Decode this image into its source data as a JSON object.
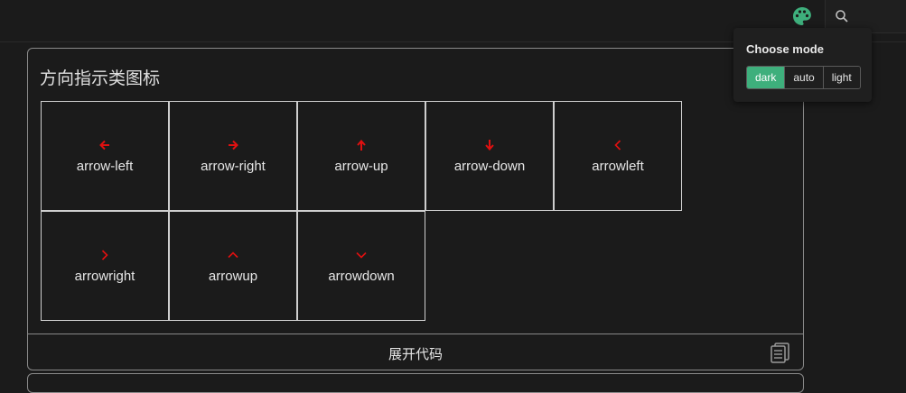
{
  "colors": {
    "accent": "#3eaf7c",
    "icon_red": "#e01010",
    "background": "#1b1b1b",
    "border": "#cfcfcf"
  },
  "topbar": {
    "palette_icon": "palette-icon",
    "search_icon": "search-icon"
  },
  "card": {
    "title": "方向指示类图标",
    "icons": [
      {
        "label": "arrow-left",
        "icon": "arrow-left-icon"
      },
      {
        "label": "arrow-right",
        "icon": "arrow-right-icon"
      },
      {
        "label": "arrow-up",
        "icon": "arrow-up-icon"
      },
      {
        "label": "arrow-down",
        "icon": "arrow-down-icon"
      },
      {
        "label": "arrowleft",
        "icon": "chevron-left-icon"
      },
      {
        "label": "arrowright",
        "icon": "chevron-right-icon"
      },
      {
        "label": "arrowup",
        "icon": "chevron-up-icon"
      },
      {
        "label": "arrowdown",
        "icon": "chevron-down-icon"
      }
    ],
    "expand_label": "展开代码",
    "copy_icon": "copy-icon"
  },
  "mode_popup": {
    "title": "Choose mode",
    "options": [
      "dark",
      "auto",
      "light"
    ],
    "selected": "dark"
  }
}
